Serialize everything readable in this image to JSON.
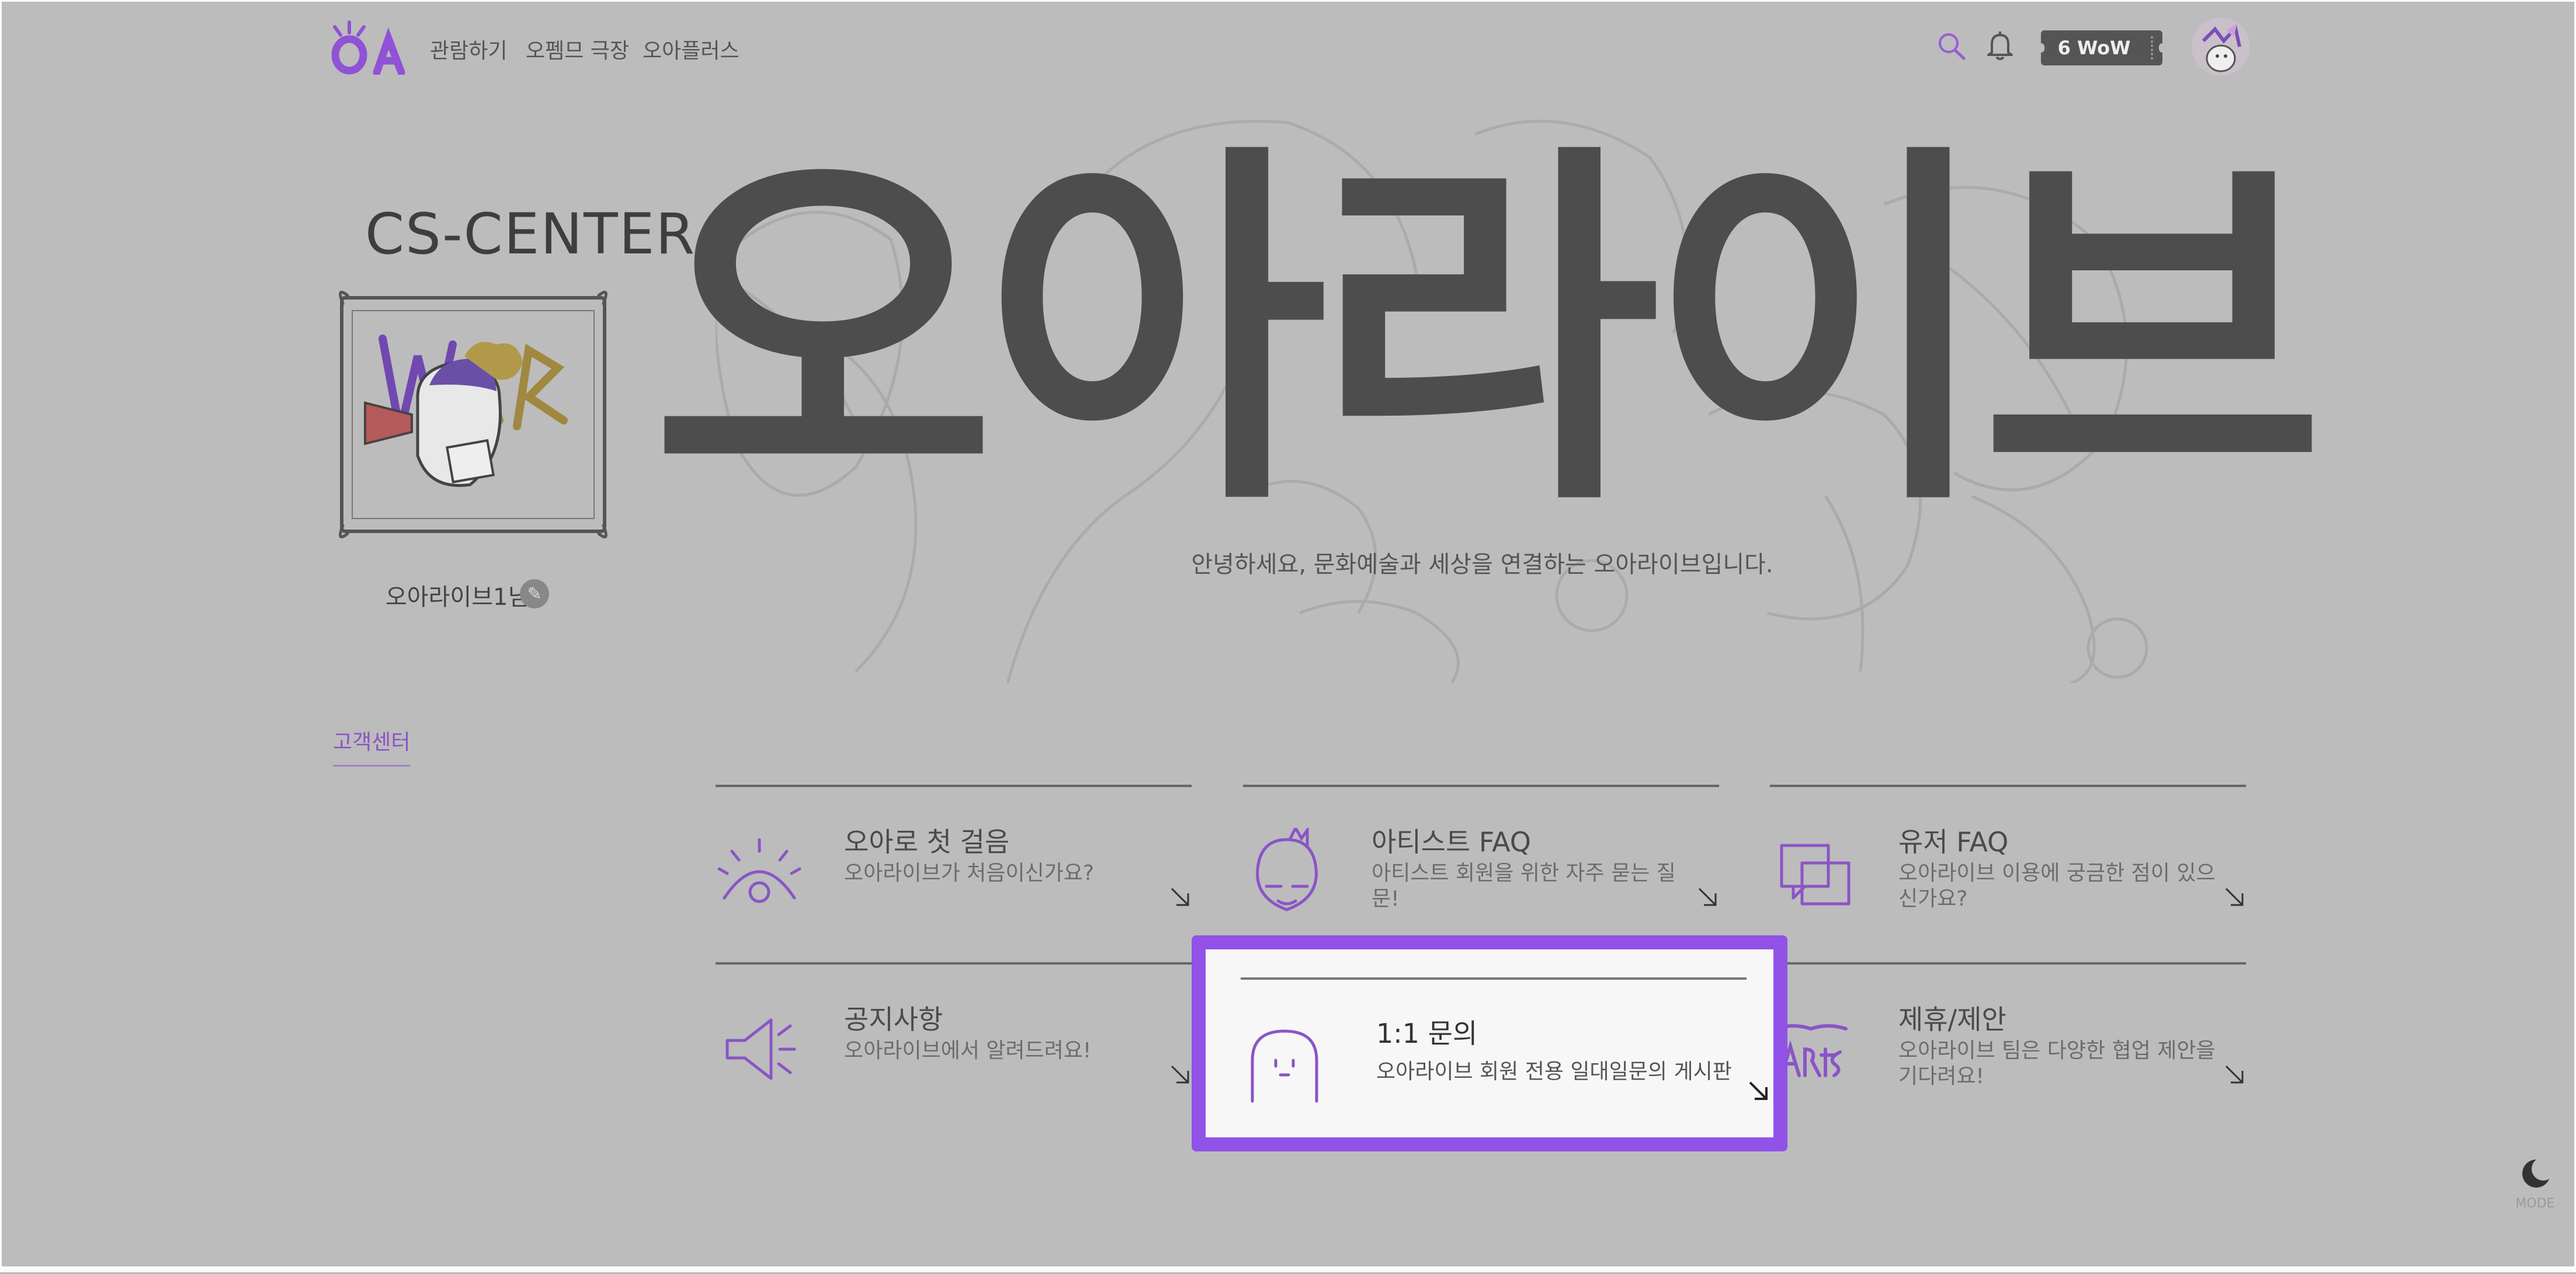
{
  "header": {
    "logo_text": "OA",
    "nav": [
      "관람하기",
      "오펨므 극장",
      "오아플러스"
    ],
    "wow_label": "6 WoW",
    "icons": [
      "search-icon",
      "bell-icon"
    ]
  },
  "profile": {
    "cs_title": "CS-CENTER",
    "username": "오아라이브1님",
    "edit_icon": "pencil-icon"
  },
  "sidebar": {
    "link": "고객센터"
  },
  "hero": {
    "title": "오아라이브",
    "subtitle": "안녕하세요, 문화예술과 세상을 연결하는 오아라이브입니다."
  },
  "cards": [
    {
      "title": "오아로 첫 걸음",
      "desc": "오아라이브가 처음이신가요?",
      "icon": "eye-icon"
    },
    {
      "title": "아티스트 FAQ",
      "desc": "아티스트 회원을 위한 자주 묻는 질문!",
      "icon": "artist-face-icon"
    },
    {
      "title": "유저 FAQ",
      "desc": "오아라이브 이용에 궁금한 점이 있으신가요?",
      "icon": "chat-bubbles-icon"
    },
    {
      "title": "공지사항",
      "desc": "오아라이브에서 알려드려요!",
      "icon": "megaphone-icon"
    },
    {
      "title": "제휴/제안",
      "desc": "오아라이브 팀은 다양한 협업 제안을 기다려요!",
      "icon": "ordinary-artist-icon"
    }
  ],
  "popup": {
    "title": "1:1 문의",
    "desc": "오아라이브 회원 전용 일대일문의 게시판",
    "icon": "ghost-icon"
  },
  "mode_toggle": {
    "label": "MODE",
    "icon": "moon-icon"
  },
  "colors": {
    "accent": "#9152e8",
    "overlay_bg": "#bcbcbc",
    "text_dark": "#4d4d4d"
  }
}
